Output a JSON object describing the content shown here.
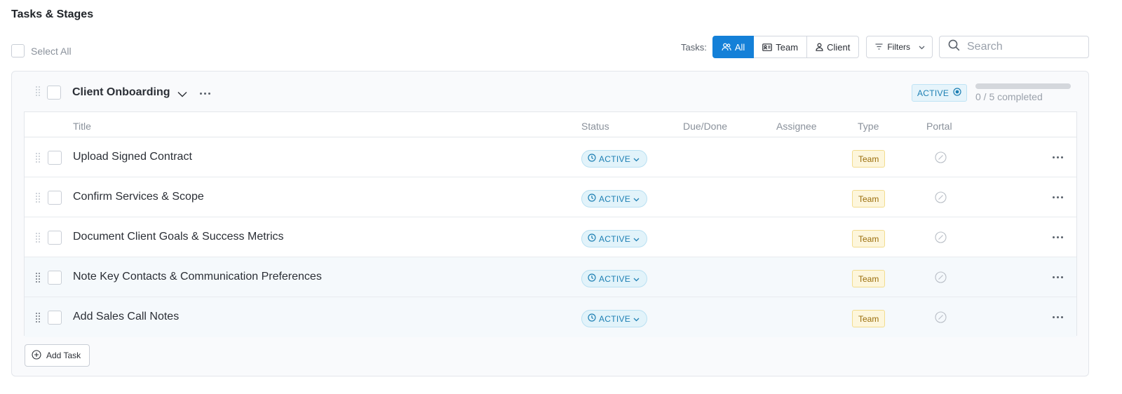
{
  "page": {
    "title": "Tasks & Stages"
  },
  "select_all": {
    "label": "Select All"
  },
  "toolbar": {
    "tasks_label": "Tasks:",
    "segments": [
      {
        "label": "All",
        "icon": "users-icon",
        "active": true
      },
      {
        "label": "Team",
        "icon": "id-card-icon",
        "active": false
      },
      {
        "label": "Client",
        "icon": "user-icon",
        "active": false
      }
    ],
    "filters_label": "Filters",
    "search_placeholder": "Search"
  },
  "stage": {
    "name": "Client Onboarding",
    "status": "ACTIVE",
    "progress_text": "0 / 5 completed",
    "progress_fraction": 0,
    "columns": [
      "Title",
      "Status",
      "Due/Done",
      "Assignee",
      "Type",
      "Portal"
    ],
    "tasks": [
      {
        "title": "Upload Signed Contract",
        "status": "ACTIVE",
        "type": "Team",
        "highlighted": false
      },
      {
        "title": "Confirm Services & Scope",
        "status": "ACTIVE",
        "type": "Team",
        "highlighted": false
      },
      {
        "title": "Document Client Goals & Success Metrics",
        "status": "ACTIVE",
        "type": "Team",
        "highlighted": false
      },
      {
        "title": "Note Key Contacts & Communication Preferences",
        "status": "ACTIVE",
        "type": "Team",
        "highlighted": true
      },
      {
        "title": "Add Sales Call Notes",
        "status": "ACTIVE",
        "type": "Team",
        "highlighted": true
      }
    ],
    "add_task_label": "Add Task"
  },
  "colors": {
    "accent": "#1480d8",
    "status_bg": "#e2f3fa",
    "status_text": "#1d7fb3",
    "type_bg": "#fdf6dc",
    "type_text": "#9a6d0a"
  }
}
